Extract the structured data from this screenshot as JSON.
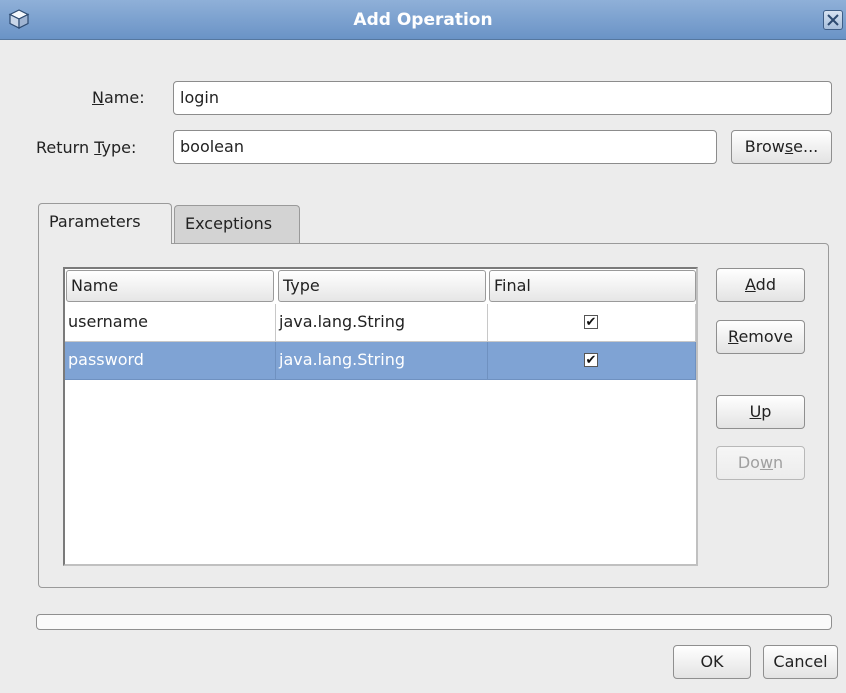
{
  "window": {
    "title": "Add Operation"
  },
  "form": {
    "name_label": "Name:",
    "name_value": "login",
    "return_type_label": "Return Type:",
    "return_type_value": "boolean",
    "browse_label": "Browse..."
  },
  "tabs": [
    {
      "label": "Parameters",
      "active": true
    },
    {
      "label": "Exceptions",
      "active": false
    }
  ],
  "table": {
    "columns": [
      "Name",
      "Type",
      "Final"
    ],
    "rows": [
      {
        "name": "username",
        "type": "java.lang.String",
        "final": true,
        "selected": false
      },
      {
        "name": "password",
        "type": "java.lang.String",
        "final": true,
        "selected": true
      }
    ]
  },
  "side_buttons": {
    "add": "Add",
    "remove": "Remove",
    "up": "Up",
    "down": "Down"
  },
  "footer": {
    "ok": "OK",
    "cancel": "Cancel"
  },
  "icons": {
    "app": "cube-icon",
    "close": "close-icon"
  },
  "colors": {
    "titlebar": "#7ba0cf",
    "selection": "#7fa3d4"
  }
}
